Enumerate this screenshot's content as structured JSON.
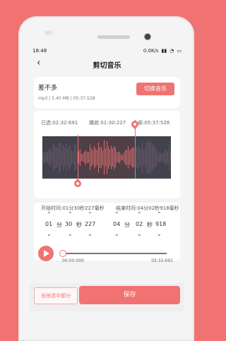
{
  "device": {
    "logo": "MI"
  },
  "status_bar": {
    "time": "18:48",
    "speed": "0.0K/s"
  },
  "header": {
    "title": "剪切音乐"
  },
  "song": {
    "name": "差不多",
    "meta": "mp3 | 5.40 MB | 05:37:528",
    "switch_label": "切换音乐"
  },
  "wave": {
    "selected_label": "已选:02:32:691",
    "play_label": "播放:01:30:227",
    "total_label": "全部:05:37:528",
    "selection": {
      "start_fraction": 0.27,
      "end_fraction": 0.72
    }
  },
  "time_range": {
    "start_label": "开始时间:01分30秒227毫秒",
    "end_label": "结束时间:04分02秒918毫秒",
    "start": {
      "min": "01",
      "sec": "30",
      "ms": "227"
    },
    "end": {
      "min": "04",
      "sec": "02",
      "ms": "918"
    },
    "units": {
      "min": "分",
      "sec": "秒"
    }
  },
  "player": {
    "current": "00:00:000",
    "duration": "02:32:691",
    "progress": 0
  },
  "actions": {
    "remove_label": "去除选中部分",
    "save_label": "保存"
  },
  "colors": {
    "accent": "#f07272",
    "wave_bg": "#41424d"
  }
}
